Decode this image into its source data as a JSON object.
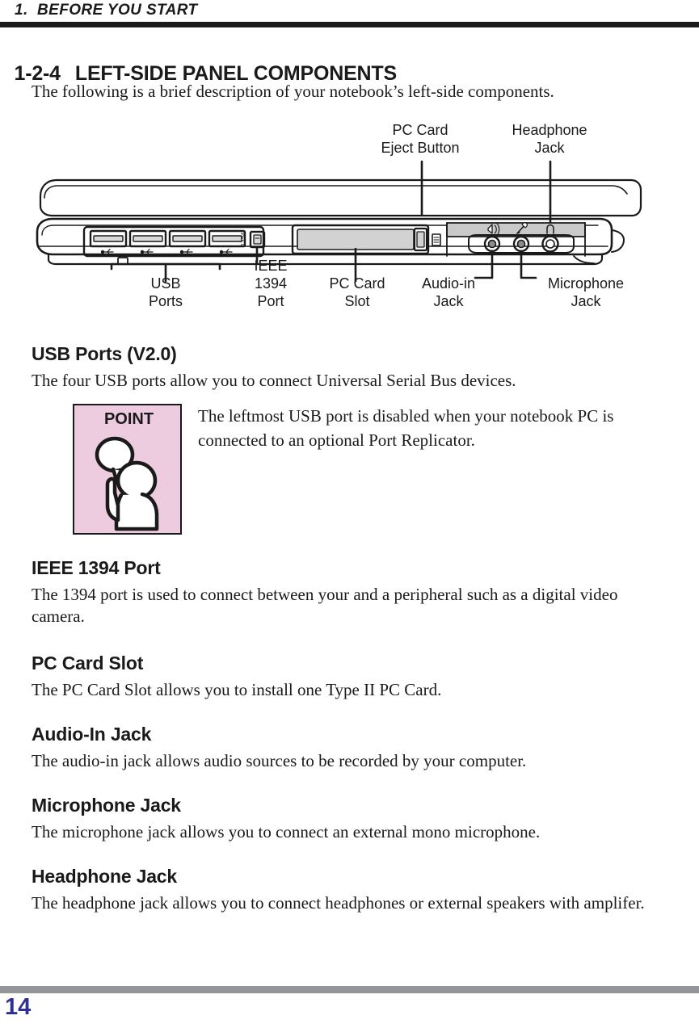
{
  "header": {
    "running_head": "1.  BEFORE YOU START"
  },
  "section": {
    "number": "1-2-4",
    "title": "LEFT-SIDE PANEL COMPONENTS",
    "intro": "The following is a brief description of your notebook’s left-side components."
  },
  "diagram": {
    "caption_labels": {
      "pc_card_eject_button": "PC Card\nEject Button",
      "headphone_jack": "Headphone\nJack",
      "usb_ports": "USB\nPorts",
      "ieee_1394_port": "IEEE\n1394\nPort",
      "pc_card_slot": "PC Card\nSlot",
      "audio_in_jack": "Audio-in\nJack",
      "microphone_jack": "Microphone\nJack"
    },
    "port_icons": {
      "usb": "usb-trident-icon",
      "ieee1394": "ieee1394-y-icon",
      "audio_in": "audio-in-icon",
      "microphone": "microphone-icon",
      "headphone": "headphone-icon"
    },
    "ieee_port_marking": "1394"
  },
  "sections": [
    {
      "heading": "USB Ports (V2.0)",
      "body": "The four USB ports allow you to connect Universal Serial Bus devices."
    },
    {
      "heading": "IEEE 1394 Port",
      "body": "The 1394 port is used to connect between your and a peripheral such as a digital video camera."
    },
    {
      "heading": "PC Card Slot",
      "body": "The PC Card Slot allows you to install one Type II PC Card."
    },
    {
      "heading": "Audio-In Jack",
      "body": "The audio-in jack allows audio sources to be recorded by your computer."
    },
    {
      "heading": "Microphone Jack",
      "body": "The microphone jack allows you to connect an external mono microphone."
    },
    {
      "heading": "Headphone Jack",
      "body": "The headphone jack allows you to connect headphones or external speakers with amplifer."
    }
  ],
  "callout": {
    "label": "POINT",
    "text": "The leftmost USB port is disabled when your notebook PC is connected to an optional Port Replicator.",
    "background_color": "#eeccdf",
    "icon": "person-pointing-icon"
  },
  "footer": {
    "page_number": "14",
    "rule_color": "#939598",
    "page_number_color": "#2e3192"
  }
}
